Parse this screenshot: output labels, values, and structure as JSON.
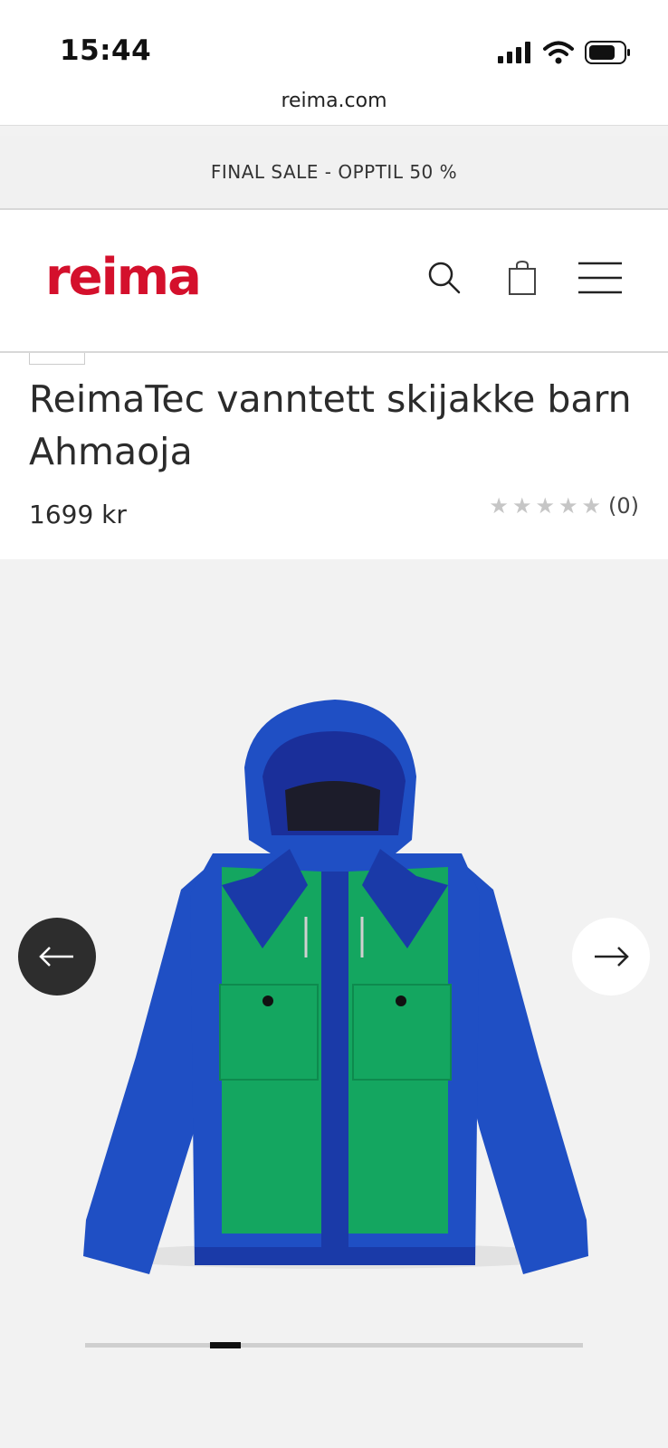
{
  "status_bar": {
    "time": "15:44"
  },
  "browser": {
    "url": "reima.com"
  },
  "promo": {
    "text": "FINAL SALE - OPPTIL 50 %"
  },
  "header": {
    "logo": "reima",
    "brand_color": "#d4102c",
    "icons": [
      "search-icon",
      "shopping-bag-icon",
      "menu-icon"
    ]
  },
  "product": {
    "title": "ReimaTec vanntett skijakke barn Ahmaoja",
    "price": "1699 kr",
    "rating": {
      "stars": 5,
      "filled": 0,
      "review_count": "(0)"
    }
  },
  "gallery": {
    "image_alt": "Blue and green children's ski jacket with hood",
    "colors": {
      "blue": "#1f4fc4",
      "dark_blue": "#1a3aa8",
      "green": "#14a660"
    },
    "icons": [
      "arrow-left-icon",
      "arrow-right-icon"
    ],
    "progress": {
      "position": 0.25
    }
  }
}
